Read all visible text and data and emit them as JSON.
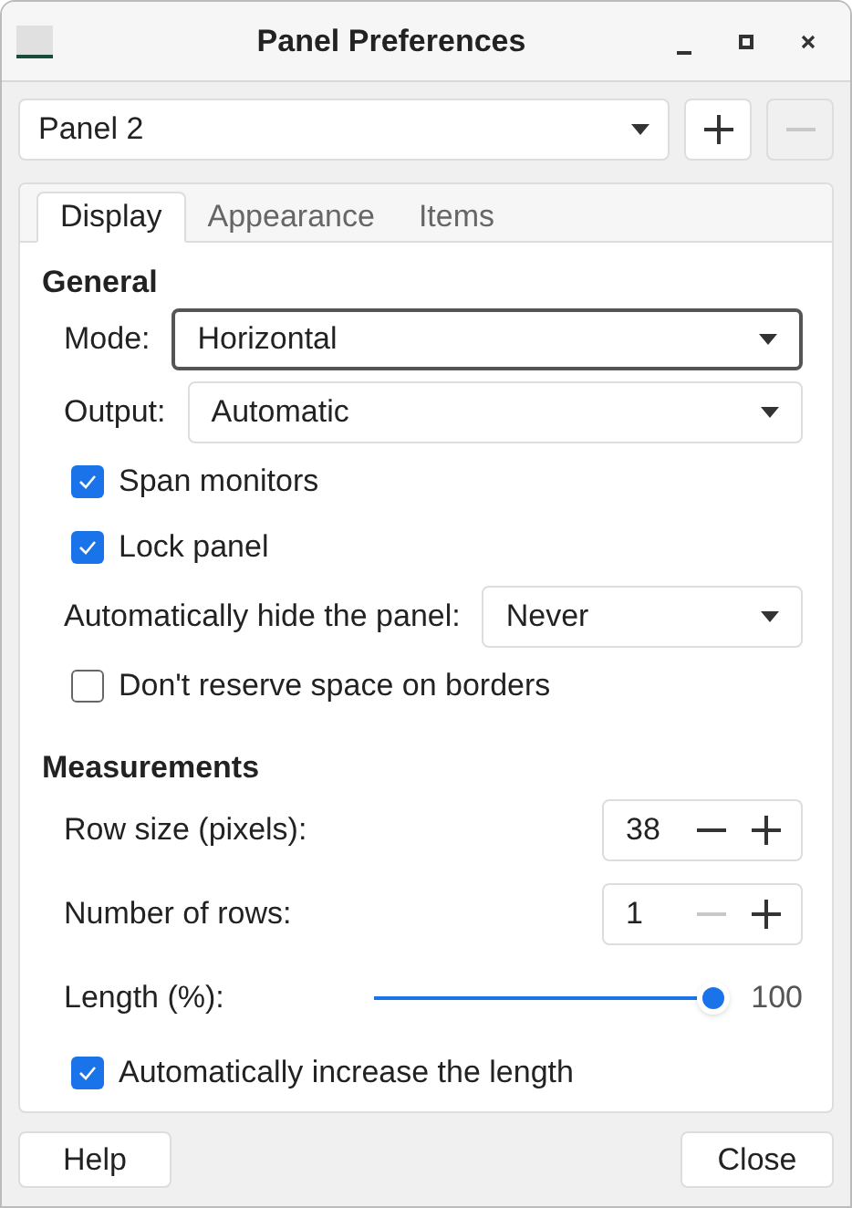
{
  "window": {
    "title": "Panel Preferences"
  },
  "panel_selector": {
    "value": "Panel 2",
    "add_disabled": false,
    "remove_disabled": true
  },
  "tabs": [
    {
      "label": "Display",
      "selected": true
    },
    {
      "label": "Appearance",
      "selected": false
    },
    {
      "label": "Items",
      "selected": false
    }
  ],
  "sections": [
    {
      "title": "General",
      "items": [
        {
          "kind": "dropdown",
          "label": "Mode:",
          "value": "Horizontal",
          "focused": true
        },
        {
          "kind": "dropdown",
          "label": "Output:",
          "value": "Automatic",
          "focused": false
        },
        {
          "kind": "checkbox",
          "label": "Span monitors",
          "checked": true
        },
        {
          "kind": "checkbox",
          "label": "Lock panel",
          "checked": true
        },
        {
          "kind": "dropdown",
          "label": "Automatically hide the panel:",
          "value": "Never",
          "focused": false
        },
        {
          "kind": "checkbox",
          "label": "Don't reserve space on borders",
          "checked": false
        }
      ]
    },
    {
      "title": "Measurements",
      "items": [
        {
          "kind": "spin",
          "label": "Row size (pixels):",
          "value": "38",
          "minus_disabled": false,
          "plus_disabled": false
        },
        {
          "kind": "spin",
          "label": "Number of rows:",
          "value": "1",
          "minus_disabled": true,
          "plus_disabled": false
        },
        {
          "kind": "slider",
          "label": "Length (%):",
          "level": 1,
          "reading": "100"
        },
        {
          "kind": "checkbox",
          "label": "Automatically increase the length",
          "checked": true
        }
      ]
    }
  ],
  "buttons": [
    "Help",
    "Close"
  ]
}
